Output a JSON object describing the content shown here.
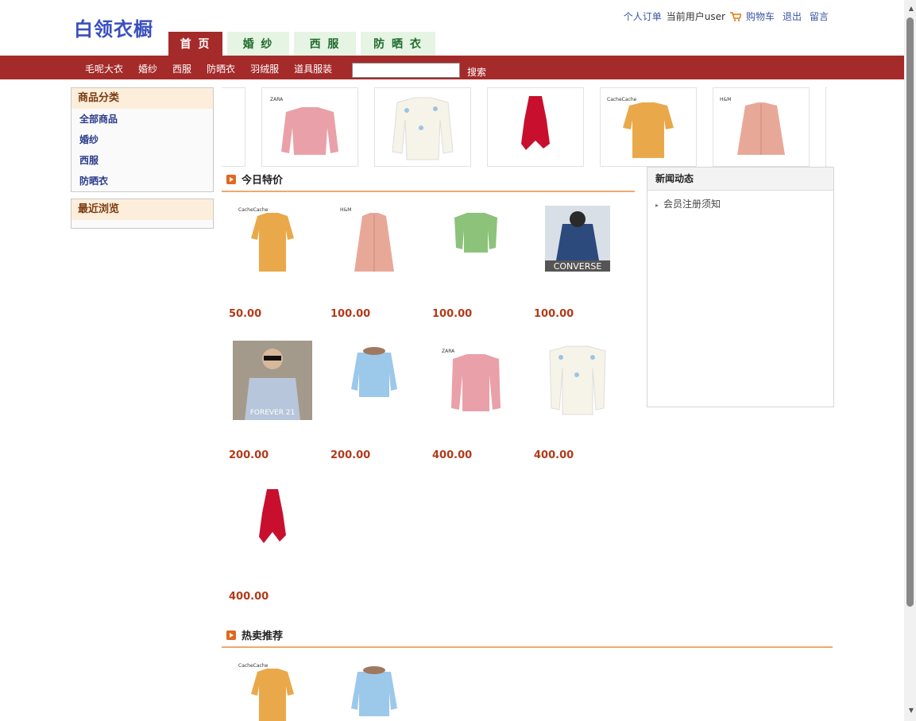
{
  "site": {
    "logo": "白领衣橱"
  },
  "topnav": {
    "orders": "个人订单",
    "current_user": "当前用户user",
    "cart": "购物车",
    "logout": "退出",
    "message": "留言"
  },
  "tabs": [
    "首 页",
    "婚 纱",
    "西 服",
    "防 晒 衣"
  ],
  "catnav": [
    "毛呢大衣",
    "婚纱",
    "西服",
    "防晒衣",
    "羽绒服",
    "道具服装"
  ],
  "search": {
    "value": "",
    "button": "搜索"
  },
  "sidebar": {
    "category_title": "商品分类",
    "categories": [
      "全部商品",
      "婚纱",
      "西服",
      "防晒衣"
    ],
    "recent_title": "最近浏览"
  },
  "carousel": [
    {
      "icon": "pink-sweater",
      "brand": "ZARA"
    },
    {
      "icon": "white-sweater",
      "brand": ""
    },
    {
      "icon": "red-dress",
      "brand": ""
    },
    {
      "icon": "yellow-tee",
      "brand": "CacheCache"
    },
    {
      "icon": "pink-coat",
      "brand": "H&M"
    }
  ],
  "today_special": {
    "title": "今日特价",
    "products": [
      {
        "icon": "yellow-tee",
        "brand": "CacheCache",
        "price": "50.00"
      },
      {
        "icon": "pink-coat",
        "brand": "H&M",
        "price": "100.00"
      },
      {
        "icon": "green-sweater",
        "brand": "",
        "price": "100.00"
      },
      {
        "icon": "converse-photo",
        "brand": "CONVERSE",
        "price": "100.00"
      },
      {
        "icon": "forever21-photo",
        "brand": "FOREVER 21",
        "price": "200.00"
      },
      {
        "icon": "blue-down-jacket",
        "brand": "",
        "price": "200.00"
      },
      {
        "icon": "pink-sweater",
        "brand": "ZARA",
        "price": "400.00"
      },
      {
        "icon": "white-sweater",
        "brand": "",
        "price": "400.00"
      },
      {
        "icon": "red-dress",
        "brand": "",
        "price": "400.00"
      }
    ]
  },
  "news": {
    "title": "新闻动态",
    "items": [
      "会员注册须知"
    ]
  },
  "hot": {
    "title": "热卖推荐",
    "products": [
      {
        "icon": "yellow-tee",
        "brand": "CacheCache"
      },
      {
        "icon": "blue-down-jacket",
        "brand": ""
      }
    ]
  },
  "colors": {
    "brand_red": "#a52a2a",
    "tab_green": "#e6f4e4",
    "price_red": "#b23a1a",
    "logo_blue": "#3a4fbf"
  }
}
